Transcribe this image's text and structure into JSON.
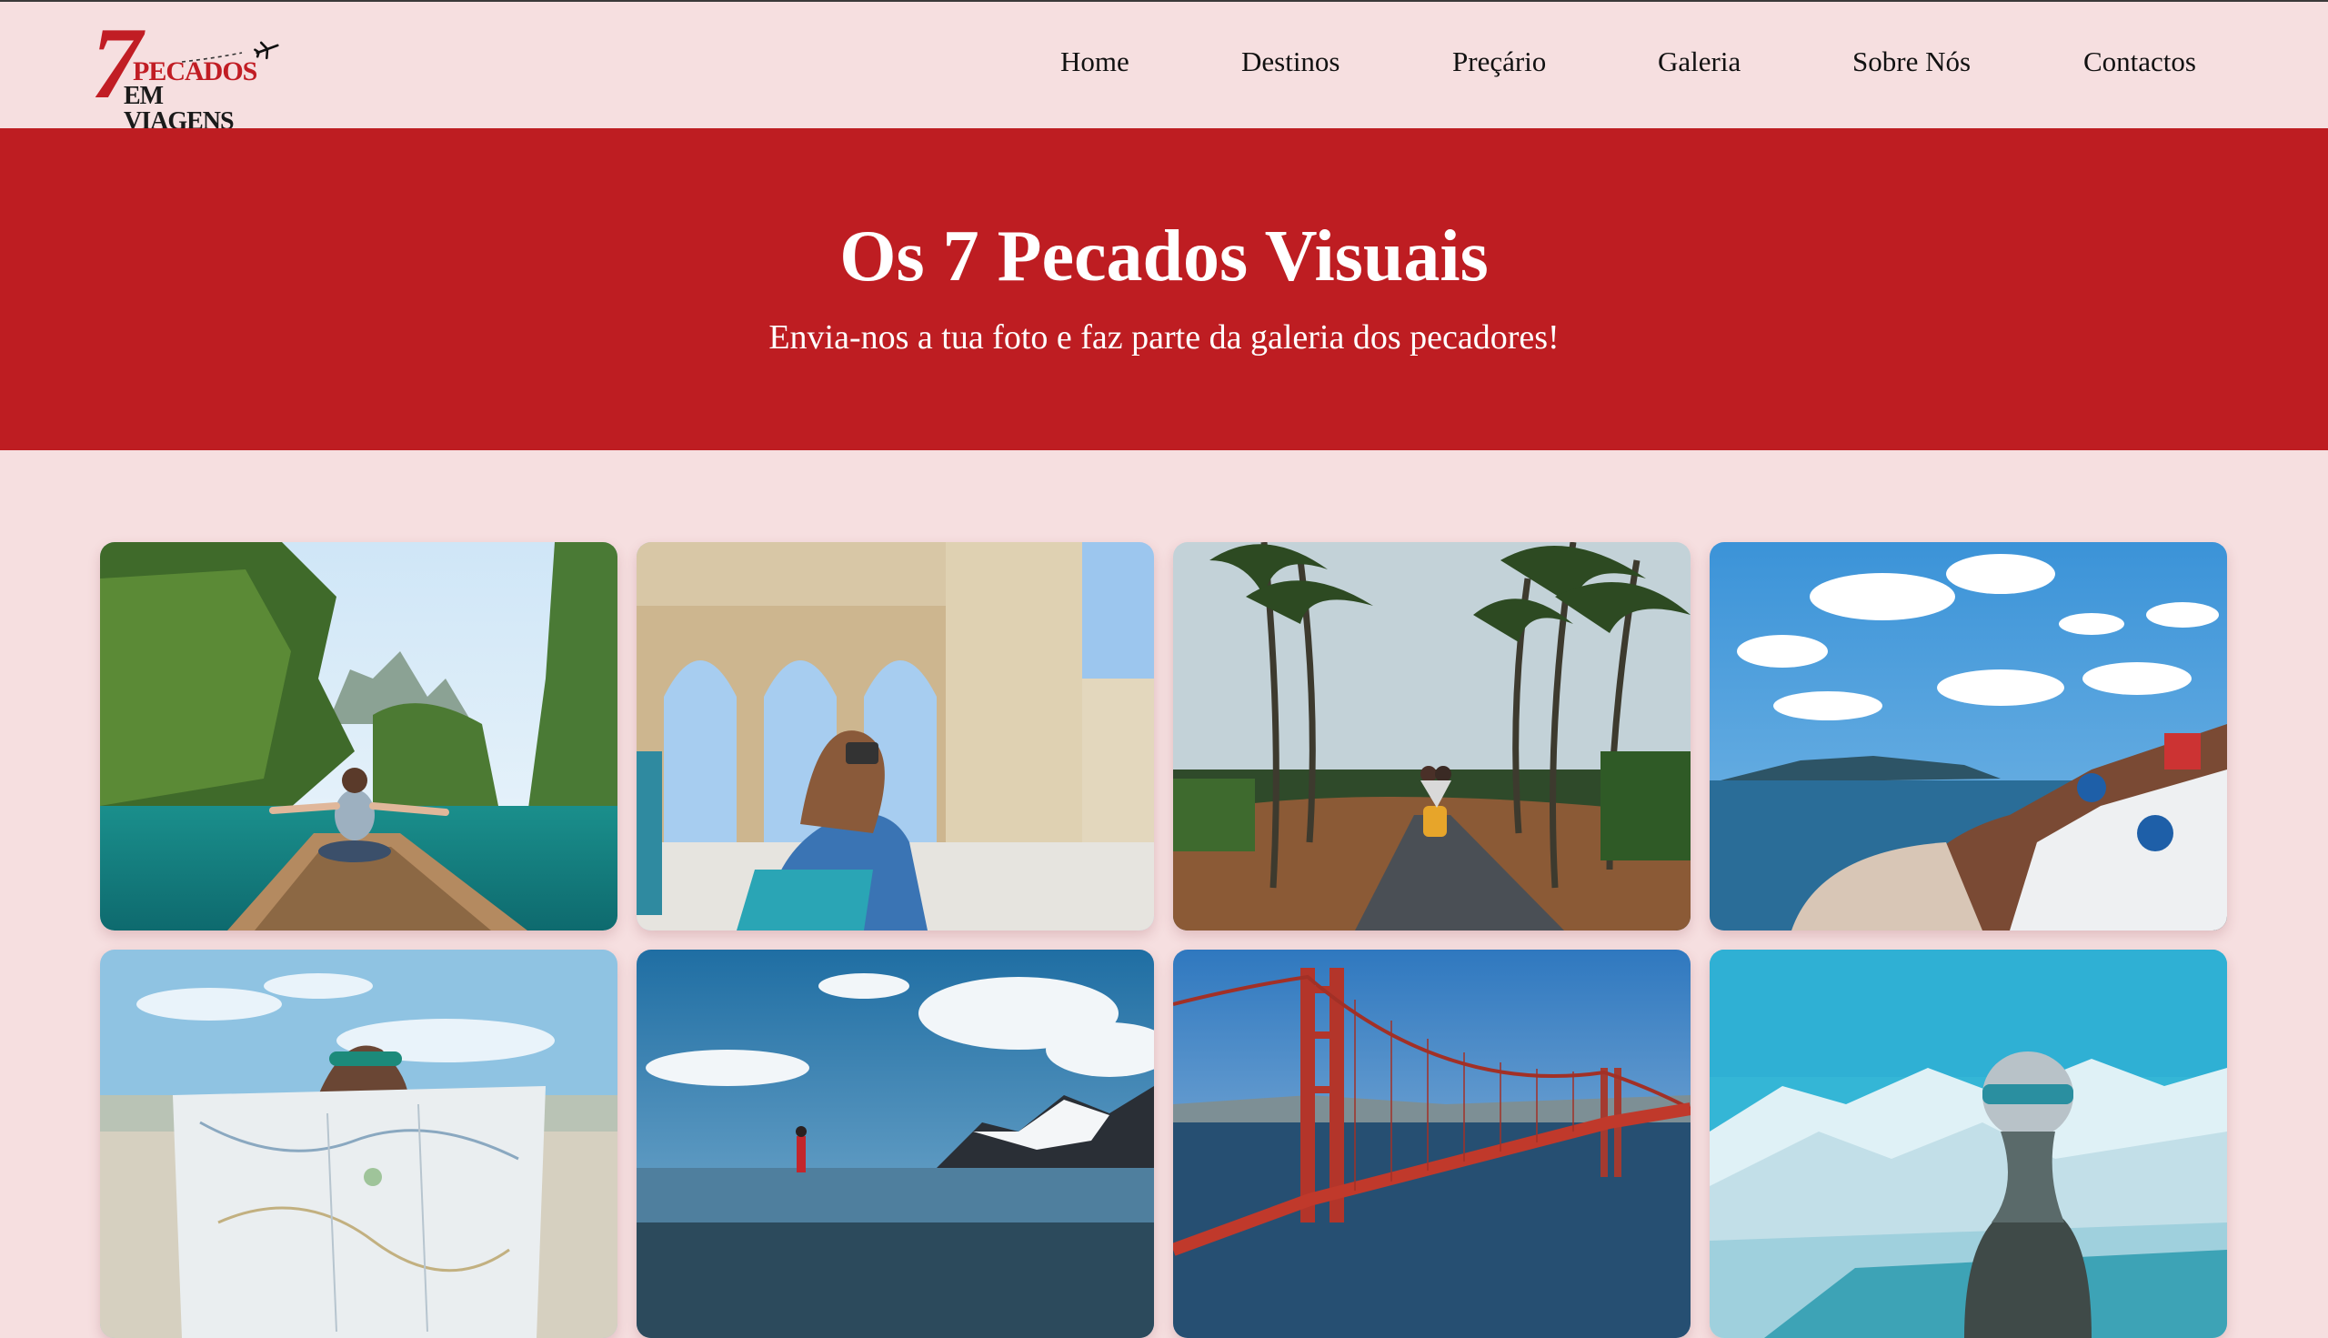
{
  "logo": {
    "number": "7",
    "line1": "PECADOS",
    "line2": "EM VIAGENS",
    "icon": "airplane-icon"
  },
  "nav": {
    "items": [
      {
        "label": "Home"
      },
      {
        "label": "Destinos"
      },
      {
        "label": "Preçário"
      },
      {
        "label": "Galeria"
      },
      {
        "label": "Sobre Nós"
      },
      {
        "label": "Contactos"
      }
    ]
  },
  "hero": {
    "title": "Os 7 Pecados Visuais",
    "subtitle": "Envia-nos a tua foto e faz parte da galeria dos pecadores!"
  },
  "gallery": {
    "photos": [
      {
        "subject": "woman sitting on boat in tropical lagoon"
      },
      {
        "subject": "woman photographing stone arches"
      },
      {
        "subject": "couple on yellow scooter on palm tree road"
      },
      {
        "subject": "santorini white village by the sea"
      },
      {
        "subject": "woman reading a large map"
      },
      {
        "subject": "person standing on shore facing snowy mountains"
      },
      {
        "subject": "golden gate bridge over bay"
      },
      {
        "subject": "woman with beanie looking at snowy mountains"
      }
    ]
  },
  "colors": {
    "background": "#f6dfe0",
    "hero": "#be1d22",
    "brand_red": "#c11d24",
    "nav_text": "#111111"
  }
}
